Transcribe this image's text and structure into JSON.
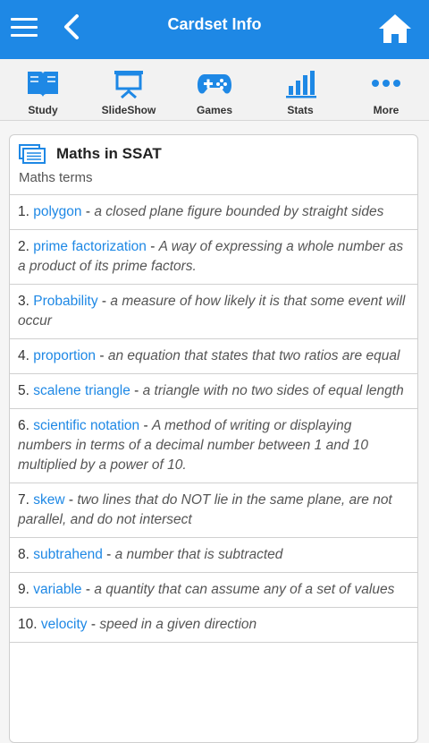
{
  "header": {
    "title": "Cardset Info"
  },
  "toolbar": {
    "items": [
      {
        "label": "Study",
        "icon": "book-icon"
      },
      {
        "label": "SlideShow",
        "icon": "presentation-icon"
      },
      {
        "label": "Games",
        "icon": "gamepad-icon"
      },
      {
        "label": "Stats",
        "icon": "bar-chart-icon"
      },
      {
        "label": "More",
        "icon": "more-dots-icon"
      }
    ]
  },
  "cardset": {
    "title": "Maths in SSAT",
    "description": "Maths terms",
    "cards": [
      {
        "num": "1.",
        "term": "polygon",
        "sep": " - ",
        "def": "a closed plane figure bounded by straight sides"
      },
      {
        "num": "2.",
        "term": "prime factorization",
        "sep": " - ",
        "def": "A way of expressing a whole number as a product of its prime factors."
      },
      {
        "num": "3.",
        "term": "Probability",
        "sep": " - ",
        "def": "a measure of how likely it is that some event will occur"
      },
      {
        "num": "4.",
        "term": "proportion",
        "sep": " - ",
        "def": "an equation that states that two ratios are equal"
      },
      {
        "num": "5.",
        "term": "scalene triangle",
        "sep": " - ",
        "def": "a triangle with no two sides of equal length"
      },
      {
        "num": "6.",
        "term": "scientific notation",
        "sep": " - ",
        "def": "A method of writing or displaying numbers in terms of a decimal number between 1 and 10 multiplied by a power of 10."
      },
      {
        "num": "7.",
        "term": "skew",
        "sep": " - ",
        "def": "two lines that do NOT lie in the same plane, are not parallel, and do not intersect"
      },
      {
        "num": "8.",
        "term": "subtrahend",
        "sep": " - ",
        "def": "a number that is subtracted"
      },
      {
        "num": "9.",
        "term": "variable",
        "sep": " - ",
        "def": "a quantity that can assume any of a set of values"
      },
      {
        "num": "10.",
        "term": "velocity",
        "sep": " - ",
        "def": "speed in a given direction"
      }
    ]
  },
  "colors": {
    "appbar": "#1e88e5",
    "term": "#1e88e5",
    "icon": "#1e88e5"
  }
}
